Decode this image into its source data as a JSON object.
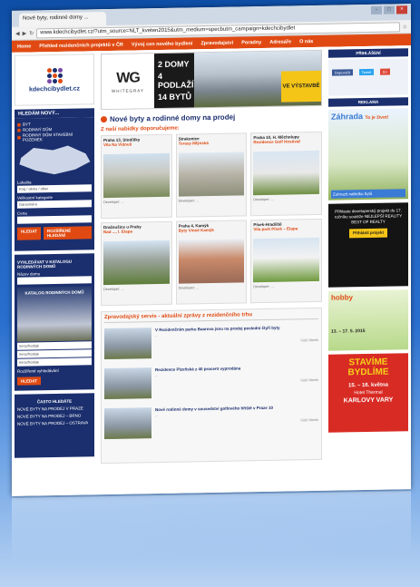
{
  "browser": {
    "tab_title": "Nové byty, rodinné domy ...",
    "url": "www.kdechcibydlet.cz/?utm_source=NLT_kveten2015&utm_medium=specbutm_campaign=kdechcibydlet",
    "win_min": "-",
    "win_max": "□",
    "win_close": "×"
  },
  "nav": [
    "Home",
    "Přehled rezidenčních projektů v ČR",
    "Vývoj cen nového bydlení",
    "Zpravodajství",
    "Poradny",
    "Adresáře",
    "O nás"
  ],
  "logo": {
    "text": "kdechcibydlet.cz",
    "dot_colors": [
      "#e04a12",
      "#1b2f6e",
      "#7a4aa8",
      "#1b2f6e",
      "#e04a12",
      "#1b2f6e",
      "#7a4aa8",
      "#1b2f6e",
      "#e04a12"
    ]
  },
  "search": {
    "header": "HLEDÁM NOVÝ...",
    "radio1": "BYT",
    "radio2": "RODINNÝ DŮM",
    "radio3": "RODINNÝ DŮM STAVEBNÍ POZEMEK",
    "region_label": "Lokalita",
    "region_value": "Kraj / okres / obec",
    "category_label": "Velikostní kategorie",
    "category_value": "Garsoniéra",
    "price_label": "Cena",
    "btn_search": "HLEDAT",
    "btn_advanced": "ROZŠÍŘENÉ HLEDÁNÍ"
  },
  "catalog": {
    "header": "VYHLEDÁVAT V KATALOGU RODINNÝCH DOMŮ",
    "name_label": "Název domu",
    "promo": "KATALOG RODINNÝCH DOMŮ",
    "field1": "nerozhoduje",
    "field2": "nerozhoduje",
    "field3": "nerozhoduje",
    "advanced_link": "Rozšířené vyhledávání",
    "btn": "HLEDAT"
  },
  "hot": {
    "header": "ČASTO HLEDÁTE",
    "links": [
      "NOVÉ BYTY NA PRODEJ V PRAZE",
      "NOVÉ BYTY NA PRODEJ – BRNO",
      "NOVÉ BYTY NA PRODEJ – OSTRAVA"
    ]
  },
  "hero": {
    "logo": "WG",
    "logo_sub": "WHITEGRAY",
    "line1": "2 DOMY",
    "line2": "4 PODLAŽÍ",
    "line3": "14 BYTŮ",
    "tag": "VE VÝSTAVBĚ"
  },
  "main": {
    "title": "Nové byty a rodinné domy na prodej",
    "offers_title": "Z naší nabídky doporučujeme:",
    "offers": [
      {
        "place": "Praha 13, Stodůlky",
        "name": "Vila Na Vidouli",
        "dev": "Developer: ..."
      },
      {
        "place": "Strakonice",
        "name": "Terasy Mlýnská",
        "dev": "Developer: ..."
      },
      {
        "place": "Praha 10, H. Měcholupy",
        "name": "Rezidence Golf Hostivař",
        "dev": "Developer: ..."
      },
      {
        "place": "Dražoušice u Prahy",
        "name": "Nad ..., I. Etapa",
        "dev": "Developer: ..."
      },
      {
        "place": "Praha 4, Kamýk",
        "name": "Byty Vinné Kamýk",
        "dev": "Developer: ..."
      },
      {
        "place": "Písek-Hradiště",
        "name": "Vila park Písek – Etapa",
        "dev": "Developer: ..."
      }
    ],
    "news_title": "Zpravodajský servis - aktuální zprávy z rezidenčního trhu",
    "news": [
      {
        "title": "V Rezidenčním parku Baarova jsou na prodej poslední čtyři byty",
        "desc": "...",
        "more": "Celý článek"
      },
      {
        "title": "Rezidence Plzeňská z 40 procent vyprodána",
        "desc": "...",
        "more": "Celý článek"
      },
      {
        "title": "Nové rodinné domy v sousedství golfového hřiště v Praze 10",
        "desc": "...",
        "more": "Celý článek"
      }
    ]
  },
  "right": {
    "social_header": "PŘIHLÁŠENÍ",
    "fb": "Doporučit",
    "tw": "Tweet",
    "gp": "G+",
    "ads_header": "REKLAMA",
    "zahrada": "Záhrada",
    "zahrada_tag": "To je život!",
    "zahrada_btn": "Zobrazit nabídku bytů",
    "ad2_text": "Přihlaste developerský projekt do 17. ročníku soutěže NEJLEPŠÍ REALITY BEST OF REALTY",
    "ad2_btn": "Přihlásit projekt",
    "hobby": "hobby",
    "hobby_date": "13. – 17. 5. 2015",
    "stavime1": "STAVÍME",
    "stavime2": "BYDLÍME",
    "stavime_date": "15. – 16. května",
    "stavime_place": "Hotel Thermal",
    "stavime_city": "KARLOVY VARY"
  }
}
